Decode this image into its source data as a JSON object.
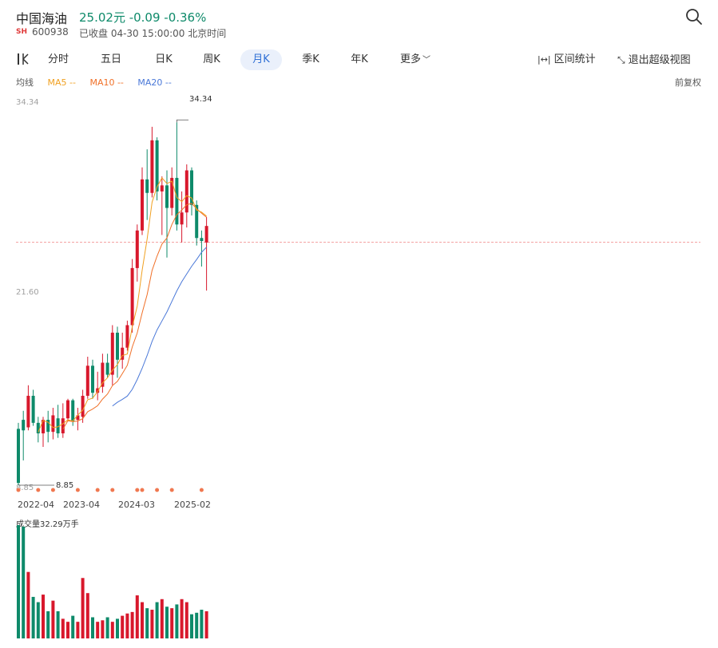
{
  "stock": {
    "name": "中国海油",
    "price_line": "25.02元 -0.09 -0.36%",
    "exchange": "SH",
    "code": "600938",
    "status": "已收盘 04-30 15:00:00 北京时间"
  },
  "tabs": [
    "分时",
    "五日",
    "日K",
    "周K",
    "月K",
    "季K",
    "年K",
    "更多"
  ],
  "active_tab": "月K",
  "tools": {
    "range_stats": "区间统计",
    "exit_super": "退出超级视图"
  },
  "ma_legend": {
    "title": "均线",
    "ma5": "MA5 --",
    "ma10": "MA10 --",
    "ma20": "MA20 --"
  },
  "adjust": "前复权",
  "colors": {
    "up": "#d8182c",
    "down": "#0e8a6a",
    "ma5": "#f0a020",
    "ma10": "#f07028",
    "ma20": "#4a78d8",
    "dashed": "#f4a2a2"
  },
  "chart_data": {
    "type": "candlestick",
    "period": "monthly",
    "ylabels": [
      "34.34",
      "21.60",
      "8.85"
    ],
    "ylim": [
      8.85,
      34.34
    ],
    "xlabels": [
      "2022-04",
      "2023-04",
      "2024-03",
      "2025-02"
    ],
    "high_label": "34.34",
    "low_label": "8.85",
    "last_close": 25.02,
    "candles": [
      [
        12.6,
        9.0,
        13.0,
        8.85
      ],
      [
        13.2,
        12.5,
        13.8,
        10.5
      ],
      [
        12.7,
        14.8,
        15.5,
        12.5
      ],
      [
        14.8,
        13.0,
        15.2,
        12.8
      ],
      [
        13.0,
        12.3,
        13.4,
        11.7
      ],
      [
        12.3,
        13.2,
        13.4,
        11.4
      ],
      [
        13.2,
        12.4,
        13.8,
        11.7
      ],
      [
        12.4,
        13.5,
        14.0,
        11.9
      ],
      [
        13.3,
        12.3,
        14.2,
        12.0
      ],
      [
        12.3,
        13.3,
        14.3,
        12.0
      ],
      [
        13.3,
        14.5,
        14.6,
        13.1
      ],
      [
        14.5,
        13.1,
        14.6,
        12.8
      ],
      [
        13.2,
        13.5,
        14.0,
        12.5
      ],
      [
        13.4,
        14.8,
        15.2,
        13.0
      ],
      [
        14.8,
        16.8,
        17.4,
        14.6
      ],
      [
        16.8,
        15.0,
        17.2,
        14.6
      ],
      [
        15.0,
        15.3,
        16.4,
        14.5
      ],
      [
        15.4,
        17.0,
        17.6,
        15.0
      ],
      [
        17.0,
        16.2,
        17.6,
        16.0
      ],
      [
        16.2,
        19.0,
        19.5,
        15.5
      ],
      [
        19.0,
        17.2,
        19.4,
        16.0
      ],
      [
        17.2,
        18.0,
        19.0,
        16.6
      ],
      [
        18.0,
        19.5,
        19.8,
        17.8
      ],
      [
        19.5,
        23.3,
        23.9,
        19.0
      ],
      [
        23.3,
        25.8,
        26.2,
        22.4
      ],
      [
        25.8,
        29.2,
        30.0,
        25.5
      ],
      [
        29.2,
        28.3,
        31.2,
        26.5
      ],
      [
        28.3,
        31.8,
        32.7,
        28.0
      ],
      [
        31.8,
        28.4,
        32.0,
        27.8
      ],
      [
        28.4,
        28.8,
        29.4,
        25.5
      ],
      [
        28.8,
        27.3,
        29.8,
        24.0
      ],
      [
        27.3,
        29.3,
        30.0,
        26.8
      ],
      [
        29.3,
        26.2,
        33.0,
        25.8
      ],
      [
        26.2,
        27.0,
        28.4,
        25.0
      ],
      [
        27.0,
        29.8,
        30.2,
        26.0
      ],
      [
        29.8,
        27.5,
        30.0,
        26.8
      ],
      [
        27.5,
        25.3,
        27.8,
        24.8
      ],
      [
        25.3,
        25.1,
        25.8,
        23.4
      ],
      [
        25.0,
        26.1,
        26.7,
        21.8
      ]
    ],
    "ma5": [
      null,
      null,
      null,
      null,
      12.38,
      13.16,
      13.04,
      12.68,
      12.74,
      12.94,
      13.2,
      13.12,
      13.52,
      13.84,
      14.54,
      14.64,
      15.08,
      15.66,
      16,
      16.5,
      16.88,
      17.48,
      17.58,
      19.4,
      20.76,
      23.16,
      25.22,
      27.68,
      28.7,
      29.3,
      28.92,
      29.08,
      28,
      27.72,
      28.12,
      27.96,
      27.16,
      27.02,
      26.76
    ],
    "ma10": [
      null,
      null,
      null,
      null,
      null,
      null,
      null,
      null,
      null,
      12.58,
      13.14,
      13.08,
      13.12,
      13.28,
      13.74,
      13.92,
      14.14,
      14.58,
      14.92,
      15.48,
      15.76,
      16.28,
      16.83,
      18.05,
      18.98,
      20.32,
      21.53,
      23.14,
      24.09,
      24.9,
      25.3,
      26.2,
      26.85,
      27.16,
      27.51,
      27.6,
      27.24,
      26.95,
      26.68
    ],
    "ma20": [
      null,
      null,
      null,
      null,
      null,
      null,
      null,
      null,
      null,
      null,
      null,
      null,
      null,
      null,
      null,
      null,
      null,
      null,
      null,
      14.12,
      14.37,
      14.56,
      14.78,
      15.23,
      15.88,
      16.63,
      17.48,
      18.42,
      19.18,
      19.78,
      20.38,
      21.08,
      21.78,
      22.39,
      22.91,
      23.42,
      23.87,
      24.35,
      24.69
    ],
    "volume_label": "成交量32.29万手",
    "volumes": [
      150,
      148,
      88,
      55,
      48,
      58,
      36,
      50,
      36,
      26,
      22,
      30,
      22,
      80,
      60,
      28,
      22,
      24,
      28,
      22,
      26,
      30,
      33,
      35,
      57,
      48,
      40,
      38,
      48,
      52,
      42,
      40,
      45,
      52,
      48,
      32,
      34,
      38,
      36
    ]
  }
}
